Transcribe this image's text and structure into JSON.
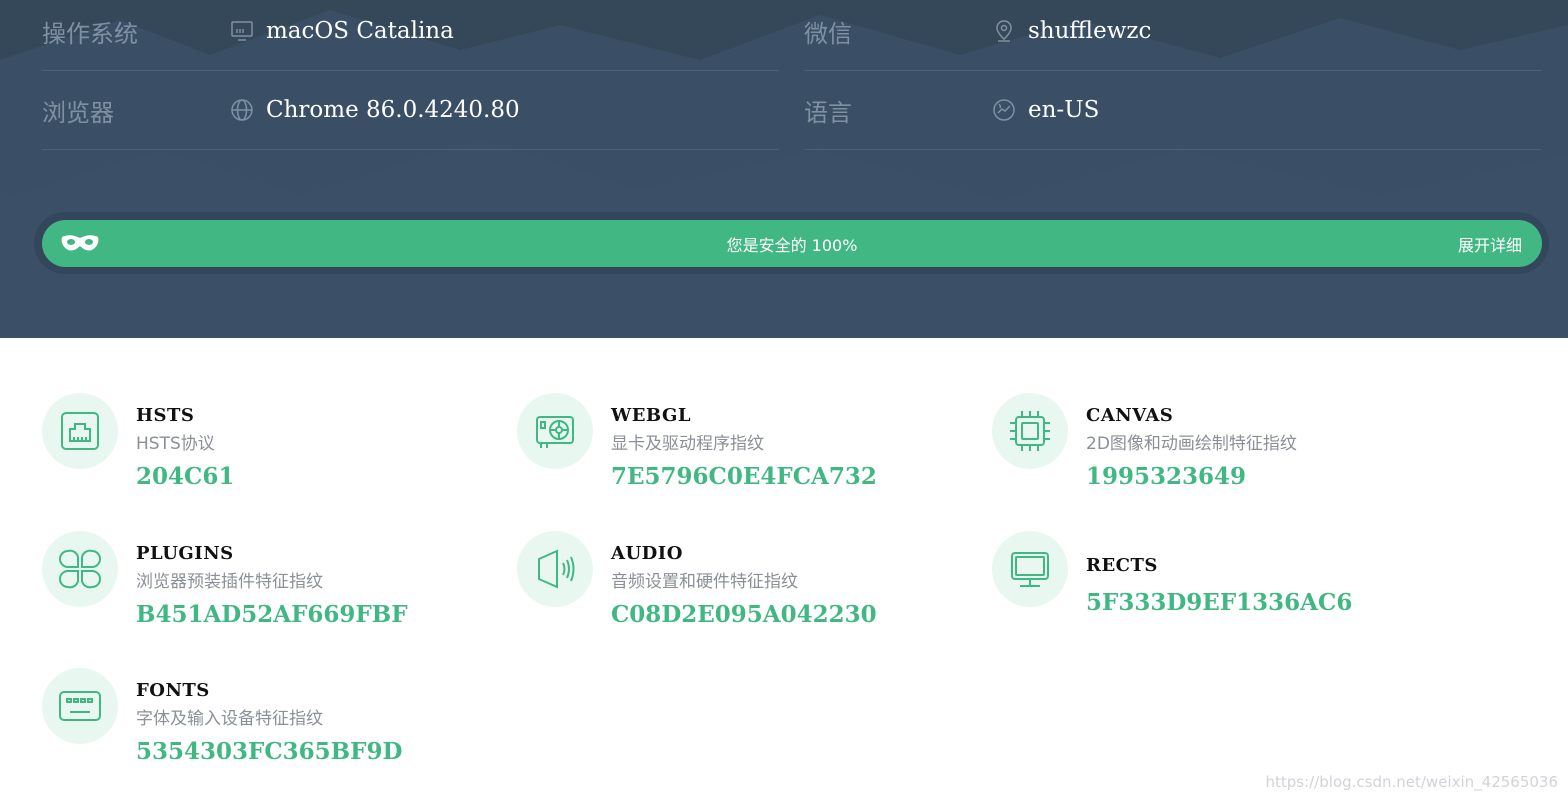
{
  "info": {
    "os": {
      "label": "操作系统",
      "icon": "monitor-icon",
      "value": "macOS Catalina"
    },
    "wechat": {
      "label": "微信",
      "icon": "location-pin-icon",
      "value": "shufflewzc"
    },
    "browser": {
      "label": "浏览器",
      "icon": "globe-icon",
      "value": "Chrome 86.0.4240.80"
    },
    "language": {
      "label": "语言",
      "icon": "language-icon",
      "value": "en-US"
    }
  },
  "safe_bar": {
    "icon": "mask-icon",
    "status": "您是安全的 100%",
    "expand_label": "展开详细",
    "color": "#41b883"
  },
  "cards": [
    {
      "title": "HSTS",
      "desc": "HSTS协议",
      "hash": "204C61",
      "icon": "ethernet-port-icon"
    },
    {
      "title": "WEBGL",
      "desc": "显卡及驱动程序指纹",
      "hash": "7E5796C0E4FCA732",
      "icon": "graphics-card-icon"
    },
    {
      "title": "CANVAS",
      "desc": "2D图像和动画绘制特征指纹",
      "hash": "1995323649",
      "icon": "cpu-chip-icon"
    },
    {
      "title": "PLUGINS",
      "desc": "浏览器预装插件特征指纹",
      "hash": "B451AD52AF669FBF",
      "icon": "plugins-grid-icon"
    },
    {
      "title": "AUDIO",
      "desc": "音频设置和硬件特征指纹",
      "hash": "C08D2E095A042230",
      "icon": "speaker-icon"
    },
    {
      "title": "RECTS",
      "desc": "",
      "hash": "5F333D9EF1336AC6",
      "icon": "monitor-screen-icon"
    },
    {
      "title": "FONTS",
      "desc": "字体及输入设备特征指纹",
      "hash": "5354303FC365BF9D",
      "icon": "keyboard-icon"
    }
  ],
  "watermark": "https://blog.csdn.net/weixin_42565036",
  "colors": {
    "header_bg": "#3a4f66",
    "accent": "#41b883",
    "icon_bg": "#e8f8f1"
  }
}
